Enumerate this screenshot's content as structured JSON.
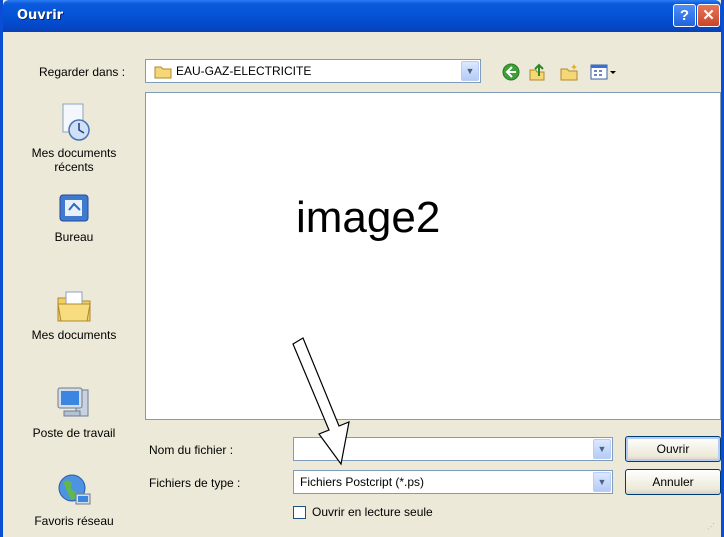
{
  "window": {
    "title": "Ouvrir"
  },
  "titlebar_buttons": {
    "help": "?",
    "close": "✕"
  },
  "lookin": {
    "label": "Regarder dans :",
    "value": "EAU-GAZ-ELECTRICITE"
  },
  "toolbar": {
    "icons": [
      "back-icon",
      "up-folder-icon",
      "new-folder-icon",
      "view-menu-icon"
    ]
  },
  "places": [
    {
      "label": "Mes documents récents",
      "icon": "recent-documents-icon"
    },
    {
      "label": "Bureau",
      "icon": "desktop-icon"
    },
    {
      "label": "Mes documents",
      "icon": "my-documents-icon"
    },
    {
      "label": "Poste de travail",
      "icon": "my-computer-icon"
    },
    {
      "label": "Favoris réseau",
      "icon": "network-places-icon"
    }
  ],
  "filelist": {
    "watermark": "image2"
  },
  "filename": {
    "label": "Nom du fichier :",
    "value": ""
  },
  "filetype": {
    "label": "Fichiers de type :",
    "value": "Fichiers Postcript (*.ps)"
  },
  "buttons": {
    "open": "Ouvrir",
    "cancel": "Annuler"
  },
  "readonly": {
    "label": "Ouvrir en lecture seule",
    "checked": false
  },
  "colors": {
    "titlebar": "#0553d6",
    "dialog_bg": "#ece9d8",
    "field_border": "#7f9db9"
  }
}
